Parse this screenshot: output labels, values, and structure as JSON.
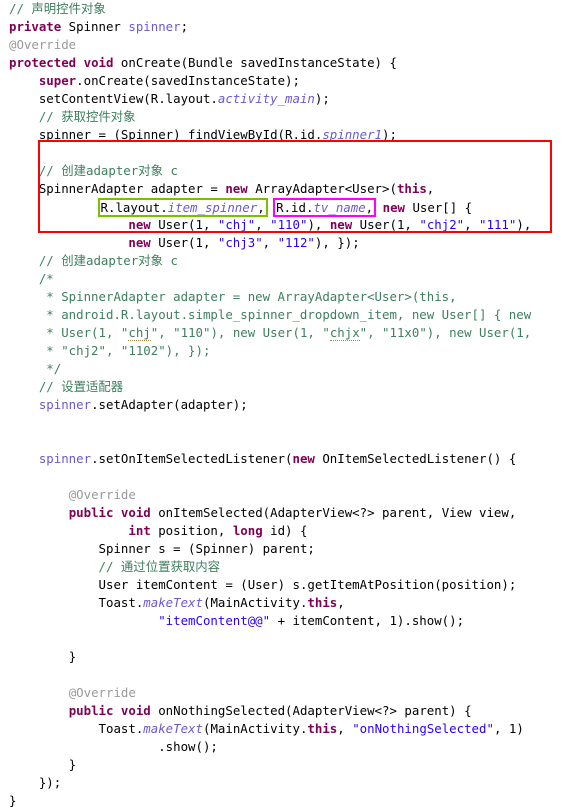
{
  "document": {
    "kind": "java-source-screenshot",
    "language": "Java",
    "background_color": "#ffffff"
  },
  "colors": {
    "keyword": "#7f0055",
    "comment": "#3f7f5f",
    "annotation": "#9a9a9a",
    "field": "#6a5acd",
    "string": "#2a00ff",
    "text": "#000000",
    "highlight_red": "#ff0000",
    "highlight_green": "#79c000",
    "highlight_pink": "#ff00ff"
  },
  "highlights": {
    "red_box_label": "create-adapter-block",
    "green_box_text": "R.layout.item_spinner,",
    "pink_box_text": "R.id.tv_name,"
  },
  "code": {
    "lines": [
      {
        "n": 1,
        "text": "// 声明控件对象"
      },
      {
        "n": 2,
        "text": "private Spinner spinner;"
      },
      {
        "n": 3,
        "text": "@Override"
      },
      {
        "n": 4,
        "text": "protected void onCreate(Bundle savedInstanceState) {"
      },
      {
        "n": 5,
        "text": "    super.onCreate(savedInstanceState);"
      },
      {
        "n": 6,
        "text": "    setContentView(R.layout.activity_main);"
      },
      {
        "n": 7,
        "text": "    // 获取控件对象"
      },
      {
        "n": 8,
        "text": "    spinner = (Spinner) findViewById(R.id.spinner1);"
      },
      {
        "n": 9,
        "text": ""
      },
      {
        "n": 10,
        "text": "    // 创建adapter对象 c"
      },
      {
        "n": 11,
        "text": "    SpinnerAdapter adapter = new ArrayAdapter<User>(this,"
      },
      {
        "n": 12,
        "text": "            R.layout.item_spinner, R.id.tv_name, new User[] {"
      },
      {
        "n": 13,
        "text": "                new User(1, \"chj\", \"110\"), new User(1, \"chj2\", \"111\"),"
      },
      {
        "n": 14,
        "text": "                new User(1, \"chj3\", \"112\"), });"
      },
      {
        "n": 15,
        "text": "    // 创建adapter对象 c"
      },
      {
        "n": 16,
        "text": "    /*"
      },
      {
        "n": 17,
        "text": "     * SpinnerAdapter adapter = new ArrayAdapter<User>(this,"
      },
      {
        "n": 18,
        "text": "     * android.R.layout.simple_spinner_dropdown_item, new User[] { new"
      },
      {
        "n": 19,
        "text": "     * User(1, \"chj\", \"110\"), new User(1, \"chjx\", \"11x0\"), new User(1,"
      },
      {
        "n": 20,
        "text": "     * \"chj2\", \"1102\"), });"
      },
      {
        "n": 21,
        "text": "     */"
      },
      {
        "n": 22,
        "text": "    // 设置适配器"
      },
      {
        "n": 23,
        "text": "    spinner.setAdapter(adapter);"
      },
      {
        "n": 24,
        "text": ""
      },
      {
        "n": 25,
        "text": ""
      },
      {
        "n": 26,
        "text": "    spinner.setOnItemSelectedListener(new OnItemSelectedListener() {"
      },
      {
        "n": 27,
        "text": ""
      },
      {
        "n": 28,
        "text": "        @Override"
      },
      {
        "n": 29,
        "text": "        public void onItemSelected(AdapterView<?> parent, View view,"
      },
      {
        "n": 30,
        "text": "                int position, long id) {"
      },
      {
        "n": 31,
        "text": "            Spinner s = (Spinner) parent;"
      },
      {
        "n": 32,
        "text": "            // 通过位置获取内容"
      },
      {
        "n": 33,
        "text": "            User itemContent = (User) s.getItemAtPosition(position);"
      },
      {
        "n": 34,
        "text": "            Toast.makeText(MainActivity.this,"
      },
      {
        "n": 35,
        "text": "                    \"itemContent@@\" + itemContent, 1).show();"
      },
      {
        "n": 36,
        "text": ""
      },
      {
        "n": 37,
        "text": "        }"
      },
      {
        "n": 38,
        "text": ""
      },
      {
        "n": 39,
        "text": "        @Override"
      },
      {
        "n": 40,
        "text": "        public void onNothingSelected(AdapterView<?> parent) {"
      },
      {
        "n": 41,
        "text": "            Toast.makeText(MainActivity.this, \"onNothingSelected\", 1)"
      },
      {
        "n": 42,
        "text": "                    .show();"
      },
      {
        "n": 43,
        "text": "        }"
      },
      {
        "n": 44,
        "text": "    });"
      },
      {
        "n": 45,
        "text": "}"
      }
    ],
    "tokens": {
      "l1_comment": "// 声明控件对象",
      "l2_kw_private": "private",
      "l2_type": " Spinner ",
      "l2_field": "spinner",
      "l2_semi": ";",
      "l3_annotation": "@Override",
      "l4_kw_protected": "protected",
      "l4_kw_void": "void",
      "l4_rest": " onCreate(Bundle savedInstanceState) {",
      "l5_kw_super": "super",
      "l5_rest": ".onCreate(savedInstanceState);",
      "l6_pre": "setContentView(R.layout.",
      "l6_field": "activity_main",
      "l6_post": ");",
      "l7_comment": "// 获取控件对象",
      "l8_pre": "spinner = (Spinner) findViewById(R.id.",
      "l8_field": "spinner1",
      "l8_post": ");",
      "l10_comment": "// 创建adapter对象 c",
      "l11_pre": "SpinnerAdapter adapter = ",
      "l11_kw_new": "new",
      "l11_mid": " ArrayAdapter<User>(",
      "l11_kw_this": "this",
      "l11_post": ",",
      "l12_boxgreen_pre": "R.layout.",
      "l12_boxgreen_field": "item_spinner",
      "l12_boxgreen_post": ",",
      "l12_boxpink_pre": "R.id.",
      "l12_boxpink_field": "tv_name",
      "l12_boxpink_post": ",",
      "l12_kw_new": "new",
      "l12_tail": " User[] {",
      "l13_kw_new1": "new",
      "l13_a": " User(1, ",
      "l13_s1": "\"chj\"",
      "l13_b": ", ",
      "l13_s2": "\"110\"",
      "l13_c": "), ",
      "l13_kw_new2": "new",
      "l13_d": " User(1, ",
      "l13_s3": "\"chj2\"",
      "l13_e": ", ",
      "l13_s4": "\"111\"",
      "l13_f": "),",
      "l14_kw_new": "new",
      "l14_a": " User(1, ",
      "l14_s1": "\"chj3\"",
      "l14_b": ", ",
      "l14_s2": "\"112\"",
      "l14_c": "), });",
      "l15_comment": "// 创建adapter对象 c",
      "l16_blockcmt": "/*",
      "l17_blockcmt": " * SpinnerAdapter adapter = new ArrayAdapter<User>(this,",
      "l18_blockcmt": " * android.R.layout.simple_spinner_dropdown_item, new User[] { new",
      "l19_blockcmt_a": " * User(1, \"",
      "l19_blockcmt_sq": "chj",
      "l19_blockcmt_b": "\", \"110\"), new User(1, \"",
      "l19_blockcmt_sq2": "chjx",
      "l19_blockcmt_c": "\", \"11x0\"), new User(1,",
      "l20_blockcmt": " * \"chj2\", \"1102\"), });",
      "l21_blockcmt": " */",
      "l22_comment": "// 设置适配器",
      "l23_field": "spinner",
      "l23_rest": ".setAdapter(adapter);",
      "l26_field": "spinner",
      "l26_mid": ".setOnItemSelectedListener(",
      "l26_kw_new": "new",
      "l26_post": " OnItemSelectedListener() {",
      "l28_annotation": "@Override",
      "l29_kw_public": "public",
      "l29_kw_void": "void",
      "l29_rest": " onItemSelected(AdapterView<?> parent, View view,",
      "l30_kw_int": "int",
      "l30_mid": " position, ",
      "l30_kw_long": "long",
      "l30_post": " id) {",
      "l31_text": "Spinner s = (Spinner) parent;",
      "l32_comment": "// 通过位置获取内容",
      "l33_text": "User itemContent = (User) s.getItemAtPosition(position);",
      "l34_pre": "Toast.",
      "l34_method": "makeText",
      "l34_mid": "(MainActivity.",
      "l34_kw_this": "this",
      "l34_post": ",",
      "l35_str": "\"itemContent@@\"",
      "l35_rest": " + itemContent, 1).show();",
      "l37_brace": "}",
      "l39_annotation": "@Override",
      "l40_kw_public": "public",
      "l40_kw_void": "void",
      "l40_rest": " onNothingSelected(AdapterView<?> parent) {",
      "l41_pre": "Toast.",
      "l41_method": "makeText",
      "l41_mid": "(MainActivity.",
      "l41_kw_this": "this",
      "l41_mid2": ", ",
      "l41_str": "\"onNothingSelected\"",
      "l41_post": ", 1)",
      "l42_text": ".show();",
      "l43_brace": "}",
      "l44_text": "});",
      "l45_brace": "}"
    }
  }
}
